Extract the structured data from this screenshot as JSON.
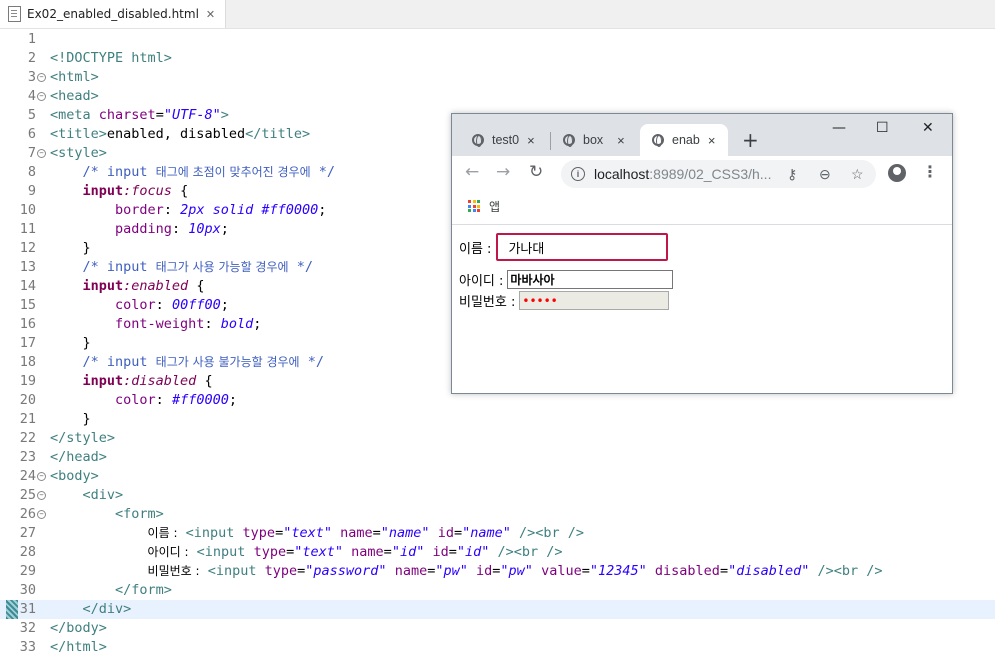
{
  "editor": {
    "tab": {
      "filename": "Ex02_enabled_disabled.html",
      "close": "✕"
    }
  },
  "browser": {
    "tabs": [
      {
        "label": "test0",
        "close": "×"
      },
      {
        "label": "box",
        "close": "×"
      },
      {
        "label": "enab",
        "close": "×"
      }
    ],
    "new_tab": "+",
    "window_controls": {
      "minimize": "—",
      "maximize": "☐",
      "close": "✕"
    },
    "nav": {
      "back": "←",
      "forward": "→",
      "reload": "↻"
    },
    "address": {
      "host": "localhost",
      "path": ":8989/02_CSS3/h..."
    },
    "bookmarks": {
      "apps_label": "앱"
    },
    "page": {
      "name_label": "이름 :",
      "name_value": "가나대",
      "id_label": "아이디 :",
      "id_value": "마바사아",
      "pw_label": "비밀번호 :",
      "pw_value": "12345"
    }
  },
  "colors": {
    "focus_border": "#c0174a",
    "disabled_text": "#ff0000",
    "current_line": "#e8f2fe"
  }
}
